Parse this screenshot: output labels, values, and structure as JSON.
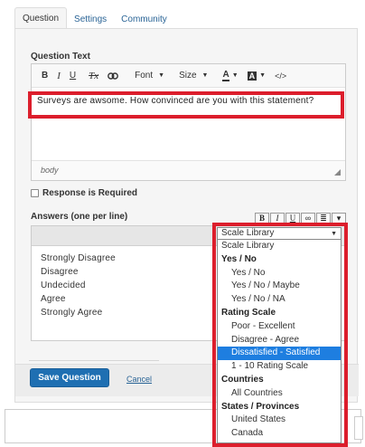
{
  "tabs": [
    "Question",
    "Settings",
    "Community"
  ],
  "question_text": {
    "label": "Question Text",
    "toolbar": {
      "bold": "B",
      "italic": "I",
      "underline": "U",
      "clear_format": "Tx",
      "link": "∞",
      "font": "Font",
      "size": "Size",
      "text_color": "A",
      "bg_color": "A",
      "source": "</>"
    },
    "content": "Surveys are awsome. How convinced are you with this statement?",
    "footer": "body"
  },
  "required": {
    "label": "Response is Required",
    "checked": false
  },
  "answers": {
    "label": "Answers (one per line)",
    "buttons": [
      "B",
      "I",
      "U",
      "∞",
      "≣",
      "▾"
    ],
    "items": [
      "Strongly Disagree",
      "Disagree",
      "Undecided",
      "Agree",
      "Strongly Agree"
    ]
  },
  "actions": {
    "save": "Save Question",
    "cancel": "Cancel"
  },
  "scale_dropdown": {
    "selected": "Scale Library",
    "options": [
      {
        "text": "Scale Library",
        "kind": "plain"
      },
      {
        "text": "Yes / No",
        "kind": "head"
      },
      {
        "text": "Yes / No",
        "kind": "item"
      },
      {
        "text": "Yes / No / Maybe",
        "kind": "item"
      },
      {
        "text": "Yes / No / NA",
        "kind": "item"
      },
      {
        "text": "Rating Scale",
        "kind": "head"
      },
      {
        "text": "Poor - Excellent",
        "kind": "item"
      },
      {
        "text": "Disagree - Agree",
        "kind": "item"
      },
      {
        "text": "Dissatisfied - Satisfied",
        "kind": "item",
        "highlighted": true
      },
      {
        "text": "1 - 10 Rating Scale",
        "kind": "item"
      },
      {
        "text": "Countries",
        "kind": "head"
      },
      {
        "text": "All Countries",
        "kind": "item"
      },
      {
        "text": "States / Provinces",
        "kind": "head"
      },
      {
        "text": "United States",
        "kind": "item"
      },
      {
        "text": "Canada",
        "kind": "item"
      }
    ]
  },
  "colors": {
    "annotation_red": "#dc1e2c",
    "primary_blue": "#1f6fb2",
    "selection_blue": "#1e7ee0",
    "link_blue": "#2a6496"
  }
}
